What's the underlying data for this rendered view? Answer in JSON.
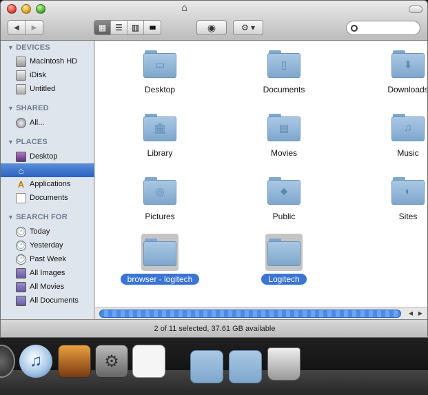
{
  "toolbar": {
    "back_label": "◀",
    "forward_label": "▶",
    "view_icon": "▦",
    "list_icon": "☰",
    "column_icon": "▥",
    "coverflow_icon": "▮▮▮",
    "eye_icon": "◉",
    "gear_label": "⚙ ▾",
    "search_placeholder": ""
  },
  "sidebar": {
    "sections": [
      {
        "label": "DEVICES"
      },
      {
        "label": "SHARED"
      },
      {
        "label": "PLACES"
      },
      {
        "label": "SEARCH FOR"
      }
    ],
    "items": [
      {
        "label": "Macintosh HD"
      },
      {
        "label": "iDisk"
      },
      {
        "label": "Untitled"
      },
      {
        "label": "All..."
      },
      {
        "label": "Desktop"
      },
      {
        "label": ""
      },
      {
        "label": "Applications"
      },
      {
        "label": "Documents"
      },
      {
        "label": "Today"
      },
      {
        "label": "Yesterday"
      },
      {
        "label": "Past Week"
      },
      {
        "label": "All Images"
      },
      {
        "label": "All Movies"
      },
      {
        "label": "All Documents"
      }
    ]
  },
  "folders": [
    {
      "label": "Desktop",
      "glyph": "▭"
    },
    {
      "label": "Documents",
      "glyph": "▯"
    },
    {
      "label": "Downloads",
      "glyph": "⬇"
    },
    {
      "label": "Library",
      "glyph": "🏛"
    },
    {
      "label": "Movies",
      "glyph": "▤"
    },
    {
      "label": "Music",
      "glyph": "♫"
    },
    {
      "label": "Pictures",
      "glyph": "◎"
    },
    {
      "label": "Public",
      "glyph": "⬥"
    },
    {
      "label": "Sites",
      "glyph": "◐"
    },
    {
      "label": "browser - logitech",
      "glyph": ""
    },
    {
      "label": "Logitech",
      "glyph": ""
    }
  ],
  "status": {
    "text": "2 of 11 selected, 37.61 GB available"
  }
}
